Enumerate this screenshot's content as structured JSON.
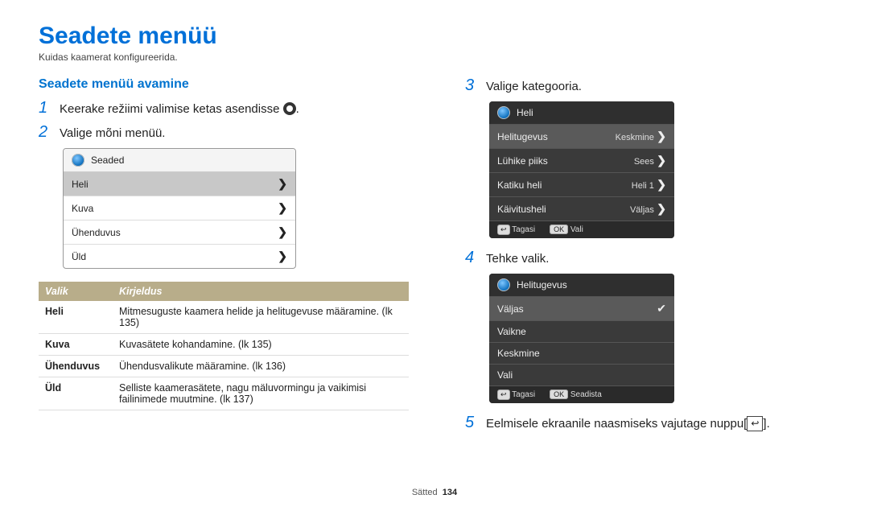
{
  "title": "Seadete menüü",
  "subtitle": "Kuidas kaamerat konfigureerida.",
  "section_title": "Seadete menüü avamine",
  "steps": {
    "s1": "Keerake režiimi valimise ketas asendisse",
    "s1_end": ".",
    "s2": "Valige mõni menüü.",
    "s3": "Valige kategooria.",
    "s4": "Tehke valik.",
    "s5_a": "Eelmisele ekraanile naasmiseks vajutage nuppu[",
    "s5_b": "]."
  },
  "nums": {
    "n1": "1",
    "n2": "2",
    "n3": "3",
    "n4": "4",
    "n5": "5"
  },
  "panel1": {
    "header": "Seaded",
    "rows": [
      "Heli",
      "Kuva",
      "Ühenduvus",
      "Üld"
    ]
  },
  "panel2": {
    "header": "Heli",
    "rows": [
      {
        "k": "Helitugevus",
        "v": "Keskmine"
      },
      {
        "k": "Lühike piiks",
        "v": "Sees"
      },
      {
        "k": "Katiku heli",
        "v": "Heli 1"
      },
      {
        "k": "Käivitusheli",
        "v": "Väljas"
      }
    ],
    "back": "Tagasi",
    "ok": "OK",
    "okl": "Vali"
  },
  "panel3": {
    "header": "Helitugevus",
    "rows": [
      "Väljas",
      "Vaikne",
      "Keskmine",
      "Vali"
    ],
    "back": "Tagasi",
    "ok": "OK",
    "okl": "Seadista"
  },
  "table": {
    "h1": "Valik",
    "h2": "Kirjeldus",
    "rows": [
      {
        "k": "Heli",
        "v": "Mitmesuguste kaamera helide ja helitugevuse määramine. (lk 135)"
      },
      {
        "k": "Kuva",
        "v": "Kuvasätete kohandamine. (lk 135)"
      },
      {
        "k": "Ühenduvus",
        "v": "Ühendusvalikute määramine. (lk 136)"
      },
      {
        "k": "Üld",
        "v": "Selliste kaamerasätete, nagu mäluvormingu ja vaikimisi failinimede muutmine. (lk 137)"
      }
    ]
  },
  "footer": {
    "section": "Sätted",
    "page": "134"
  },
  "back_glyph": "↩"
}
